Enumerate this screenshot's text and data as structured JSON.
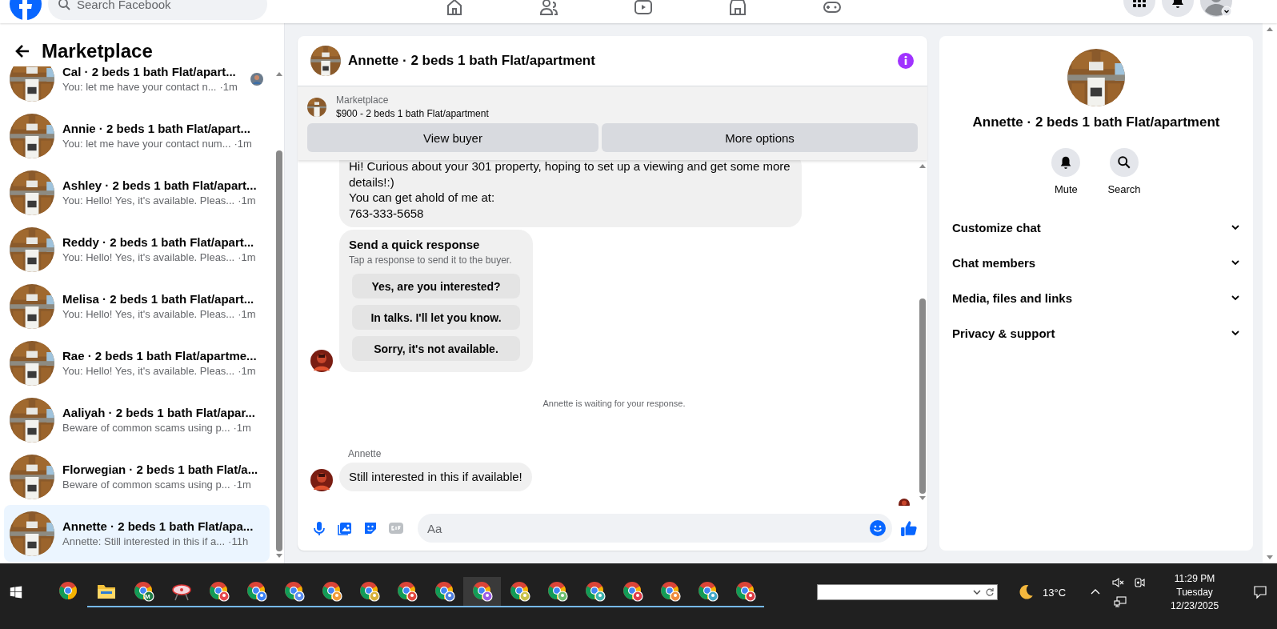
{
  "topbar": {
    "search_placeholder": "Search Facebook"
  },
  "sidebar": {
    "title": "Marketplace",
    "conversations": [
      {
        "title": "Cal · 2 beds 1 bath Flat/apart...",
        "preview": "You: let me have your contact n...",
        "time": "·1m",
        "seen": true,
        "selected": false
      },
      {
        "title": "Annie · 2 beds 1 bath Flat/apart...",
        "preview": "You: let me have your contact num...",
        "time": "·1m",
        "seen": false,
        "selected": false
      },
      {
        "title": "Ashley · 2 beds 1 bath Flat/apart...",
        "preview": "You: Hello! Yes, it's available. Pleas...",
        "time": "·1m",
        "seen": false,
        "selected": false
      },
      {
        "title": "Reddy · 2 beds 1 bath Flat/apart...",
        "preview": "You: Hello! Yes, it's available. Pleas...",
        "time": "·1m",
        "seen": false,
        "selected": false
      },
      {
        "title": "Melisa · 2 beds 1 bath Flat/apart...",
        "preview": "You: Hello! Yes, it's available. Pleas...",
        "time": "·1m",
        "seen": false,
        "selected": false
      },
      {
        "title": "Rae · 2 beds 1 bath Flat/apartme...",
        "preview": "You: Hello! Yes, it's available. Pleas...",
        "time": "·1m",
        "seen": false,
        "selected": false
      },
      {
        "title": "Aaliyah · 2 beds 1 bath Flat/apar...",
        "preview": "Beware of common scams using p...",
        "time": "·1m",
        "seen": false,
        "selected": false
      },
      {
        "title": "Florwegian · 2 beds 1 bath Flat/a...",
        "preview": "Beware of common scams using p...",
        "time": "·1m",
        "seen": false,
        "selected": false
      },
      {
        "title": "Annette · 2 beds 1 bath Flat/apa...",
        "preview": "Annette: Still interested in this if a...",
        "time": "·11h",
        "seen": false,
        "selected": true
      }
    ]
  },
  "chat": {
    "title": "Annette · 2 beds 1 bath Flat/apartment",
    "banner": {
      "label": "Marketplace",
      "listing": "$900 - 2 beds 1 bath Flat/apartment",
      "buttons": [
        "View buyer",
        "More options"
      ]
    },
    "messages": [
      {
        "kind": "bubble",
        "avatar": false,
        "lines": [
          "Hi! Curious about your 301 property, hoping to set up a viewing and get some more details!:)",
          "You can get ahold of me at:",
          "763-333-5658"
        ]
      },
      {
        "kind": "quick",
        "avatar": true,
        "title": "Send a quick response",
        "hint": "Tap a response to send it to the buyer.",
        "options": [
          "Yes, are you interested?",
          "In talks. I'll let you know.",
          "Sorry, it's not available."
        ]
      },
      {
        "kind": "status",
        "text": "Annette is waiting for your response."
      },
      {
        "kind": "bubble",
        "avatar": true,
        "sender": "Annette",
        "lines": [
          "Still interested in this if available!"
        ]
      }
    ],
    "composer": {
      "placeholder": "Aa"
    }
  },
  "details": {
    "title": "Annette · 2 beds 1 bath Flat/apartment",
    "actions": [
      {
        "kind": "mute",
        "label": "Mute"
      },
      {
        "kind": "search",
        "label": "Search"
      }
    ],
    "sections": [
      {
        "label": "Customize chat",
        "expanded": false
      },
      {
        "label": "Chat members",
        "expanded": false
      },
      {
        "label": "Media, files and links",
        "expanded": false
      },
      {
        "label": "Privacy & support",
        "expanded": false
      }
    ]
  },
  "taskbar": {
    "apps": [
      {
        "kind": "chrome",
        "running": false,
        "selected": false
      },
      {
        "kind": "folder",
        "running": true,
        "selected": false
      },
      {
        "kind": "chrome",
        "badge": "M",
        "color": "#1e7b46",
        "running": true,
        "selected": false
      },
      {
        "kind": "tool",
        "running": true,
        "selected": false
      },
      {
        "kind": "chrome",
        "color": "#e5484d",
        "running": true,
        "selected": false
      },
      {
        "kind": "chrome",
        "color": "#3b82f6",
        "running": true,
        "selected": false
      },
      {
        "kind": "chrome",
        "color": "#5b8def",
        "running": true,
        "selected": false
      },
      {
        "kind": "chrome",
        "color": "#f29b38",
        "running": true,
        "selected": false
      },
      {
        "kind": "chrome",
        "color": "#d8b13a",
        "running": true,
        "selected": false
      },
      {
        "kind": "chrome",
        "color": "#e0483e",
        "running": true,
        "selected": false
      },
      {
        "kind": "chrome",
        "color": "#4f7fe0",
        "running": true,
        "selected": false
      },
      {
        "kind": "chrome",
        "color": "#9b5de5",
        "running": true,
        "selected": true
      },
      {
        "kind": "chrome",
        "color": "#c9c24a",
        "running": true,
        "selected": false
      },
      {
        "kind": "chrome",
        "color": "#6cc070",
        "running": true,
        "selected": false
      },
      {
        "kind": "chrome",
        "color": "#3fb5b0",
        "running": true,
        "selected": false
      },
      {
        "kind": "chrome",
        "color": "#e03b4a",
        "running": true,
        "selected": false
      },
      {
        "kind": "chrome",
        "color": "#f08a3c",
        "running": true,
        "selected": false
      },
      {
        "kind": "chrome",
        "color": "#41a9c9",
        "running": true,
        "selected": false
      },
      {
        "kind": "chrome",
        "color": "#dd3b45",
        "running": true,
        "selected": false
      }
    ],
    "weather": "13°C",
    "clock": {
      "time": "11:29 PM",
      "day": "Tuesday",
      "date": "12/23/2025"
    }
  }
}
